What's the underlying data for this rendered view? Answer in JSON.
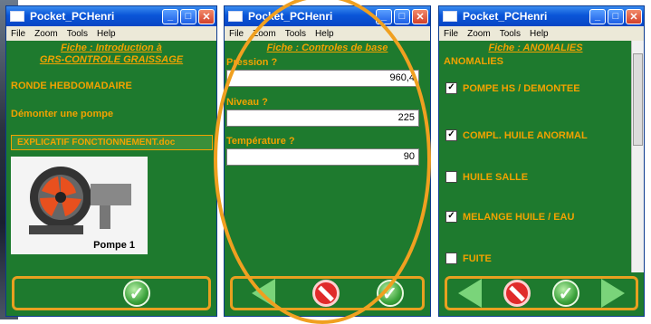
{
  "windows": [
    {
      "title": "Pocket_PCHenri",
      "menu": [
        "File",
        "Zoom",
        "Tools",
        "Help"
      ],
      "fiche_line1": "Fiche : Introduction à",
      "fiche_line2": "GRS-CONTROLE GRAISSAGE",
      "ronde": "RONDE HEBDOMADAIRE",
      "demonter": "Démonter une pompe",
      "doc_button": "EXPLICATIF FONCTIONNEMENT.doc",
      "image_caption": "Pompe 1"
    },
    {
      "title": "Pocket_PCHenri",
      "menu": [
        "File",
        "Zoom",
        "Tools",
        "Help"
      ],
      "fiche": "Fiche : Controles de base",
      "fields": [
        {
          "label": "Pression ?",
          "value": "960,4"
        },
        {
          "label": "Niveau ?",
          "value": "225"
        },
        {
          "label": "Température ?",
          "value": "90"
        }
      ]
    },
    {
      "title": "Pocket_PCHenri",
      "menu": [
        "File",
        "Zoom",
        "Tools",
        "Help"
      ],
      "fiche": "Fiche : ANOMALIES",
      "heading": "ANOMALIES",
      "checks": [
        {
          "label": "POMPE HS / DEMONTEE",
          "checked": true
        },
        {
          "label": "COMPL. HUILE ANORMAL",
          "checked": true
        },
        {
          "label": "HUILE SALLE",
          "checked": false
        },
        {
          "label": "MELANGE HUILE / EAU",
          "checked": true
        },
        {
          "label": "FUITE",
          "checked": false
        }
      ]
    }
  ],
  "colors": {
    "background_green": "#1e7a2e",
    "accent_orange": "#f2a200",
    "titlebar_blue": "#0a55d8"
  }
}
